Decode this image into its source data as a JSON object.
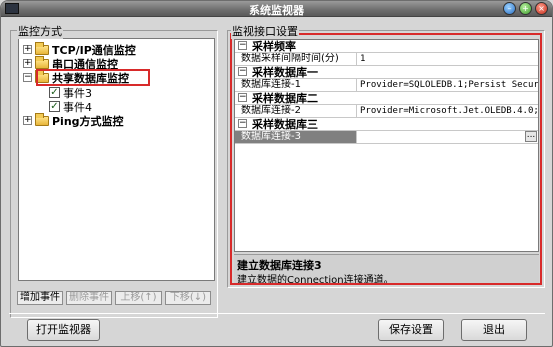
{
  "window": {
    "title": "系统监视器",
    "minimize_glyph": "–",
    "maximize_glyph": "+",
    "close_glyph": "×"
  },
  "left_group": {
    "title": "监控方式",
    "tree": [
      {
        "label": "TCP/IP通信监控",
        "expander": "+",
        "checked": false
      },
      {
        "label": "串口通信监控",
        "expander": "+",
        "checked": false
      },
      {
        "label": "共享数据库监控",
        "expander": "−",
        "checked": false
      },
      {
        "label": "事件3",
        "checked": true
      },
      {
        "label": "事件4",
        "checked": true
      },
      {
        "label": "Ping方式监控",
        "expander": "+",
        "checked": false
      }
    ],
    "buttons": {
      "add": "增加事件",
      "delete": "删除事件",
      "up": "上移(↑)",
      "down": "下移(↓)"
    }
  },
  "right_group": {
    "title": "监视接口设置",
    "categories": [
      {
        "name": "采样频率",
        "rows": [
          {
            "name": "数据采样间隔时间(分)",
            "value": "1"
          }
        ]
      },
      {
        "name": "采样数据库一",
        "rows": [
          {
            "name": "数据库连接-1",
            "value": "Provider=SQLOLEDB.1;Persist Security"
          }
        ]
      },
      {
        "name": "采样数据库二",
        "rows": [
          {
            "name": "数据库连接-2",
            "value": "Provider=Microsoft.Jet.OLEDB.4.0;Da"
          }
        ]
      },
      {
        "name": "采样数据库三",
        "rows": [
          {
            "name": "数据库连接-3",
            "value": "",
            "selected": true
          }
        ]
      }
    ],
    "collapse_glyph": "−",
    "ellipsis": "...",
    "description": {
      "title": "建立数据库连接3",
      "text": "建立数据的Connection连接通道。"
    }
  },
  "footer": {
    "open_monitor": "打开监视器",
    "save_settings": "保存设置",
    "exit": "退出"
  },
  "colors": {
    "highlight": "#d82a2a",
    "window_bg": "#d6d6d6"
  }
}
